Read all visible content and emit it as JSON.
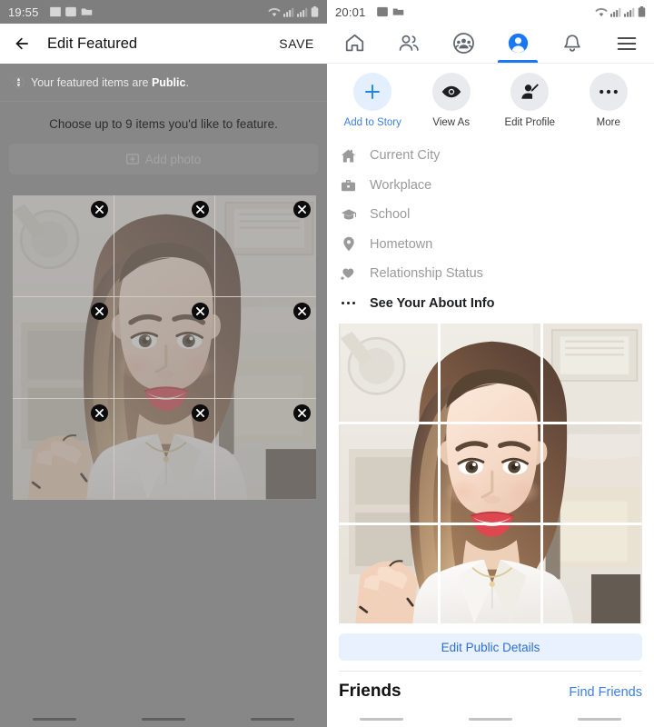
{
  "left": {
    "status": {
      "time": "19:55",
      "icons": [
        "image-icon",
        "screenshot-icon",
        "folder-icon"
      ],
      "right_icons": [
        "wifi-icon",
        "signal-icon",
        "signal-icon",
        "battery-icon"
      ]
    },
    "appbar": {
      "back": "back-arrow-icon",
      "title": "Edit Featured",
      "save_label": "SAVE"
    },
    "privacy": {
      "icon": "globe-icon",
      "prefix": "Your featured items are ",
      "value": "Public",
      "suffix": "."
    },
    "instructions": "Choose up to 9 items you'd like to feature.",
    "add_photo": {
      "icon": "add-photo-icon",
      "label": "Add photo"
    },
    "grid": {
      "tiles": 9,
      "remove_label": "✕"
    }
  },
  "right": {
    "status": {
      "time": "20:01",
      "icons": [
        "screenshot-icon",
        "folder-icon"
      ],
      "right_icons": [
        "wifi-icon",
        "signal-icon",
        "signal-icon",
        "battery-icon"
      ]
    },
    "tabs": [
      {
        "name": "home-tab",
        "icon": "home-icon",
        "active": false
      },
      {
        "name": "friends-tab",
        "icon": "friends-icon",
        "active": false
      },
      {
        "name": "groups-tab",
        "icon": "groups-icon",
        "active": false
      },
      {
        "name": "profile-tab",
        "icon": "profile-icon",
        "active": true
      },
      {
        "name": "notifications-tab",
        "icon": "bell-icon",
        "active": false
      },
      {
        "name": "menu-tab",
        "icon": "hamburger-menu-icon",
        "active": false
      }
    ],
    "actions": [
      {
        "label": "Add to Story",
        "icon": "plus-icon",
        "primary": true
      },
      {
        "label": "View As",
        "icon": "eye-icon",
        "primary": false
      },
      {
        "label": "Edit Profile",
        "icon": "edit-profile-icon",
        "primary": false
      },
      {
        "label": "More",
        "icon": "ellipsis-icon",
        "primary": false
      }
    ],
    "info": [
      {
        "label": "Current City",
        "icon": "home-filled-icon",
        "strong": false
      },
      {
        "label": "Workplace",
        "icon": "briefcase-icon",
        "strong": false
      },
      {
        "label": "School",
        "icon": "graduation-cap-icon",
        "strong": false
      },
      {
        "label": "Hometown",
        "icon": "location-pin-icon",
        "strong": false
      },
      {
        "label": "Relationship Status",
        "icon": "heart-icon",
        "strong": false
      },
      {
        "label": "See Your About Info",
        "icon": "ellipsis-icon",
        "strong": true
      }
    ],
    "edit_public_details": "Edit Public Details",
    "friends_heading": "Friends",
    "find_friends": "Find Friends"
  },
  "colors": {
    "accent_blue": "#1877f2",
    "link_blue": "#3d7fe0",
    "light_blue_bg": "#e8f1fd",
    "dim_gray": "#878787",
    "muted_text": "#9a9a9a"
  }
}
